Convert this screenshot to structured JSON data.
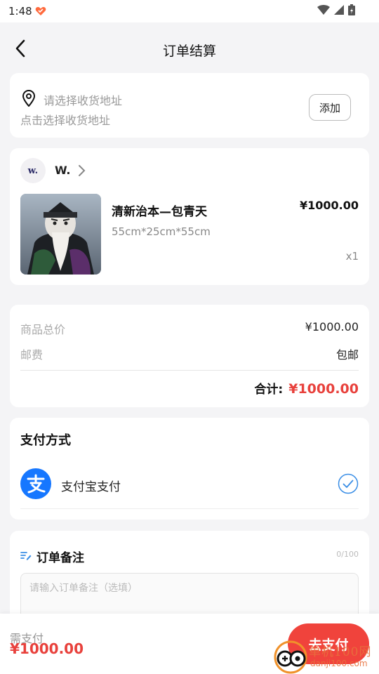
{
  "status_bar": {
    "time": "1:48",
    "app_icon": "heart-app-icon"
  },
  "header": {
    "title": "订单结算",
    "back_icon": "chevron-left-icon"
  },
  "address": {
    "prompt": "请选择收货地址",
    "subtitle": "点击选择收货地址",
    "add_label": "添加"
  },
  "shop": {
    "avatar_text": "w.",
    "name": "W."
  },
  "product": {
    "name": "清新治本—包青天",
    "spec": "55cm*25cm*55cm",
    "price": "¥1000.00",
    "quantity": "x1"
  },
  "summary": {
    "goods_total_label": "商品总价",
    "goods_total_value": "¥1000.00",
    "shipping_label": "邮费",
    "shipping_value": "包邮",
    "total_label": "合计:",
    "total_value": "¥1000.00"
  },
  "payment": {
    "title": "支付方式",
    "method": "支付宝支付",
    "icon": "alipay-icon",
    "selected": true
  },
  "remark": {
    "title": "订单备注",
    "count": "0/100",
    "placeholder": "请输入订单备注（选填）"
  },
  "bottom": {
    "need_pay_label": "需支付",
    "need_pay_amount": "¥1000.00",
    "pay_button": "去支付"
  },
  "watermark": {
    "text": "单机100网",
    "url": "danji100.com"
  },
  "colors": {
    "accent_red": "#f0433c",
    "price_red": "#e8413c",
    "alipay_blue": "#1677ff"
  }
}
